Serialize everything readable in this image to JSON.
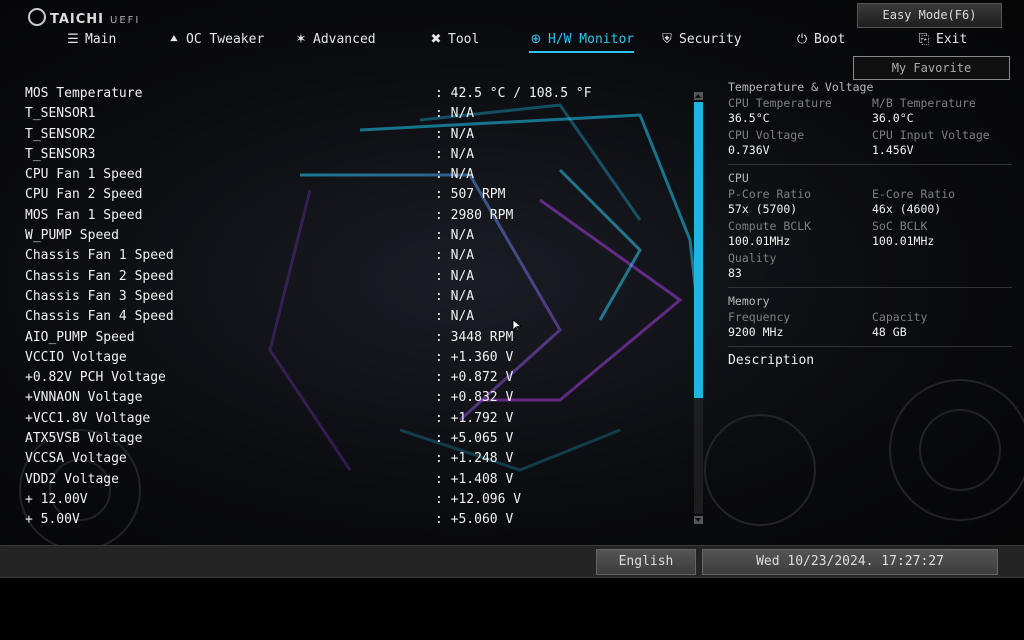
{
  "brand": {
    "name": "TAICHI",
    "suffix": "UEFI"
  },
  "easy_mode_label": "Easy Mode(F6)",
  "nav": [
    {
      "label": "Main",
      "icon": "list-icon"
    },
    {
      "label": "OC Tweaker",
      "icon": "rocket-icon"
    },
    {
      "label": "Advanced",
      "icon": "star-icon"
    },
    {
      "label": "Tool",
      "icon": "tools-icon"
    },
    {
      "label": "H/W Monitor",
      "icon": "monitor-icon",
      "active": true
    },
    {
      "label": "Security",
      "icon": "shield-icon"
    },
    {
      "label": "Boot",
      "icon": "power-icon"
    },
    {
      "label": "Exit",
      "icon": "exit-icon"
    }
  ],
  "my_favorite_label": "My Favorite",
  "readings": [
    {
      "label": "MOS Temperature",
      "value": ": 42.5 °C / 108.5 °F"
    },
    {
      "label": "T_SENSOR1",
      "value": ": N/A"
    },
    {
      "label": "T_SENSOR2",
      "value": ": N/A"
    },
    {
      "label": "T_SENSOR3",
      "value": ": N/A"
    },
    {
      "label": "CPU Fan 1 Speed",
      "value": ": N/A"
    },
    {
      "label": "CPU Fan 2 Speed",
      "value": ": 507 RPM"
    },
    {
      "label": "MOS Fan 1 Speed",
      "value": ": 2980 RPM"
    },
    {
      "label": "W_PUMP Speed",
      "value": ": N/A"
    },
    {
      "label": "Chassis Fan 1 Speed",
      "value": ": N/A"
    },
    {
      "label": "Chassis Fan 2 Speed",
      "value": ": N/A"
    },
    {
      "label": "Chassis Fan 3 Speed",
      "value": ": N/A"
    },
    {
      "label": "Chassis Fan 4 Speed",
      "value": ": N/A"
    },
    {
      "label": "AIO_PUMP Speed",
      "value": ": 3448 RPM"
    },
    {
      "label": "VCCIO Voltage",
      "value": ": +1.360 V"
    },
    {
      "label": "+0.82V PCH Voltage",
      "value": ": +0.872 V"
    },
    {
      "label": "+VNNAON Voltage",
      "value": ": +0.832 V"
    },
    {
      "label": "+VCC1.8V Voltage",
      "value": ": +1.792 V"
    },
    {
      "label": "ATX5VSB Voltage",
      "value": ": +5.065 V"
    },
    {
      "label": "VCCSA Voltage",
      "value": ": +1.248 V"
    },
    {
      "label": "VDD2 Voltage",
      "value": ": +1.408 V"
    },
    {
      "label": "+ 12.00V",
      "value": ": +12.096 V"
    },
    {
      "label": "+ 5.00V",
      "value": ": +5.060 V"
    }
  ],
  "panel": {
    "temp_voltage": {
      "title": "Temperature & Voltage",
      "items": [
        {
          "label": "CPU Temperature",
          "value": "36.5°C"
        },
        {
          "label": "M/B Temperature",
          "value": "36.0°C"
        },
        {
          "label": "CPU Voltage",
          "value": "0.736V"
        },
        {
          "label": "CPU Input Voltage",
          "value": "1.456V"
        }
      ]
    },
    "cpu": {
      "title": "CPU",
      "items": [
        {
          "label": "P-Core Ratio",
          "value": "57x (5700)"
        },
        {
          "label": "E-Core Ratio",
          "value": "46x (4600)"
        },
        {
          "label": "Compute BCLK",
          "value": "100.01MHz"
        },
        {
          "label": "SoC BCLK",
          "value": "100.01MHz"
        },
        {
          "label": "Quality",
          "value": "83"
        }
      ]
    },
    "memory": {
      "title": "Memory",
      "items": [
        {
          "label": "Frequency",
          "value": "9200 MHz"
        },
        {
          "label": "Capacity",
          "value": "48 GB"
        }
      ]
    },
    "description_title": "Description"
  },
  "footer": {
    "language": "English",
    "datetime": "Wed 10/23/2024. 17:27:27"
  },
  "colors": {
    "accent": "#2ec4ee",
    "scroll_thumb": "#1ab7e0"
  }
}
